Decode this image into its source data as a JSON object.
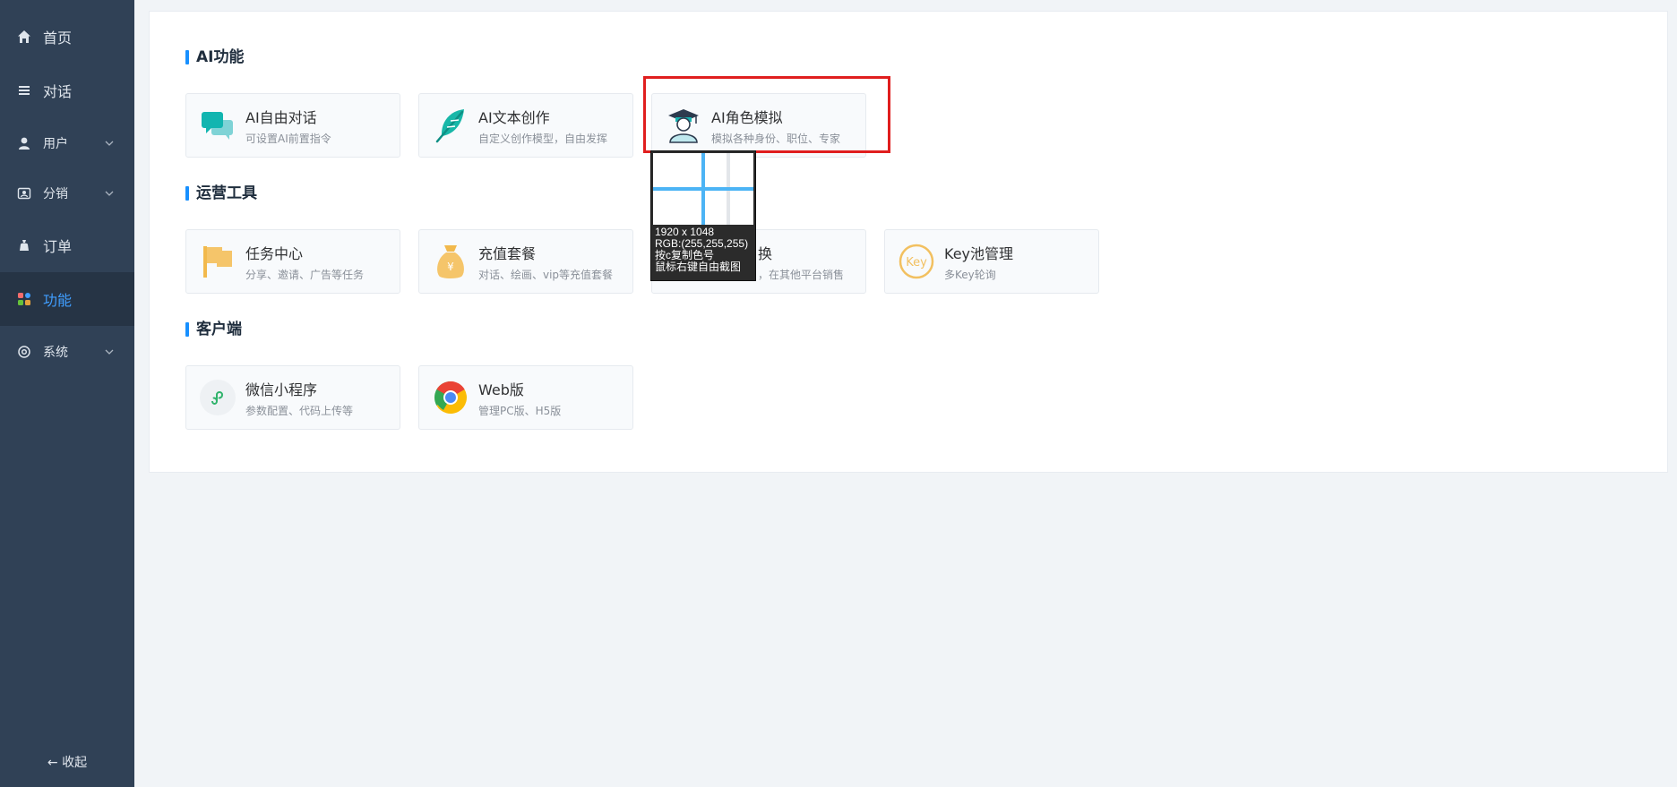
{
  "sidebar": {
    "items": [
      {
        "label": "首页",
        "icon": "home-icon"
      },
      {
        "label": "对话",
        "icon": "list-icon"
      },
      {
        "label": "用户",
        "icon": "user-icon",
        "has_children": true
      },
      {
        "label": "分销",
        "icon": "share-icon",
        "has_children": true
      },
      {
        "label": "订单",
        "icon": "bag-icon"
      },
      {
        "label": "功能",
        "icon": "apps-icon",
        "active": true
      },
      {
        "label": "系统",
        "icon": "settings-icon",
        "has_children": true
      }
    ],
    "collapse_label": "← 收起"
  },
  "sections": [
    {
      "title": "AI功能",
      "cards": [
        {
          "title": "AI自由对话",
          "desc": "可设置AI前置指令",
          "icon": "chat-bubbles-icon"
        },
        {
          "title": "AI文本创作",
          "desc": "自定义创作模型，自由发挥",
          "icon": "feather-icon"
        },
        {
          "title": "AI角色模拟",
          "desc": "模拟各种身份、职位、专家",
          "icon": "graduate-icon"
        }
      ]
    },
    {
      "title": "运营工具",
      "cards": [
        {
          "title": "任务中心",
          "desc": "分享、邀请、广告等任务",
          "icon": "flag-icon"
        },
        {
          "title": "充值套餐",
          "desc": "对话、绘画、vip等充值套餐",
          "icon": "money-bag-icon"
        },
        {
          "title": "换",
          "desc": "，在其他平台销售",
          "icon": "exchange-icon"
        },
        {
          "title": "Key池管理",
          "desc": "多Key轮询",
          "icon": "key-badge-icon"
        }
      ]
    },
    {
      "title": "客户端",
      "cards": [
        {
          "title": "微信小程序",
          "desc": "参数配置、代码上传等",
          "icon": "miniprogram-icon"
        },
        {
          "title": "Web版",
          "desc": "管理PC版、H5版",
          "icon": "chrome-icon"
        }
      ]
    }
  ],
  "picker": {
    "size": "1920 x 1048",
    "rgb": "RGB:(255,255,255)",
    "hint1": "按c复制色号",
    "hint2": "鼠标右键自由截图"
  },
  "colors": {
    "sidebar_bg": "#304156",
    "active": "#409eff",
    "accent_bar": "#1890ff",
    "highlight": "#e01e1e"
  }
}
